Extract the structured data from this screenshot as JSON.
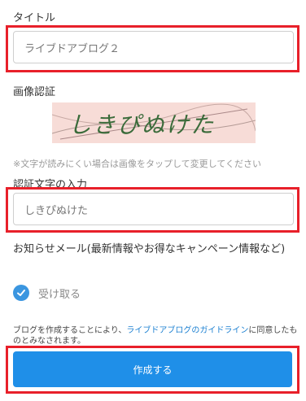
{
  "title_label": "タイトル",
  "title_input": {
    "value": "ライブドアブログ２"
  },
  "captcha": {
    "label": "画像認証",
    "image_text": "しきぴぬけた",
    "hint": "※文字が読みにくい場合は画像をタップして変更してください"
  },
  "captcha_input": {
    "label": "認証文字の入力",
    "value": "しきぴぬけた"
  },
  "newsletter": {
    "label": "お知らせメール(最新情報やお得なキャンペーン情報など)",
    "checkbox_label": "受け取る",
    "checked": true
  },
  "terms": {
    "prefix": "ブログを作成することにより、",
    "link": "ライブドアブログのガイドライン",
    "suffix": "に同意したものとみなされます。"
  },
  "submit_label": "作成する",
  "colors": {
    "accent": "#1f8fe8",
    "highlight": "#e8202a",
    "captcha_bg": "#f7dcd7",
    "captcha_text": "#3a6b3a"
  }
}
